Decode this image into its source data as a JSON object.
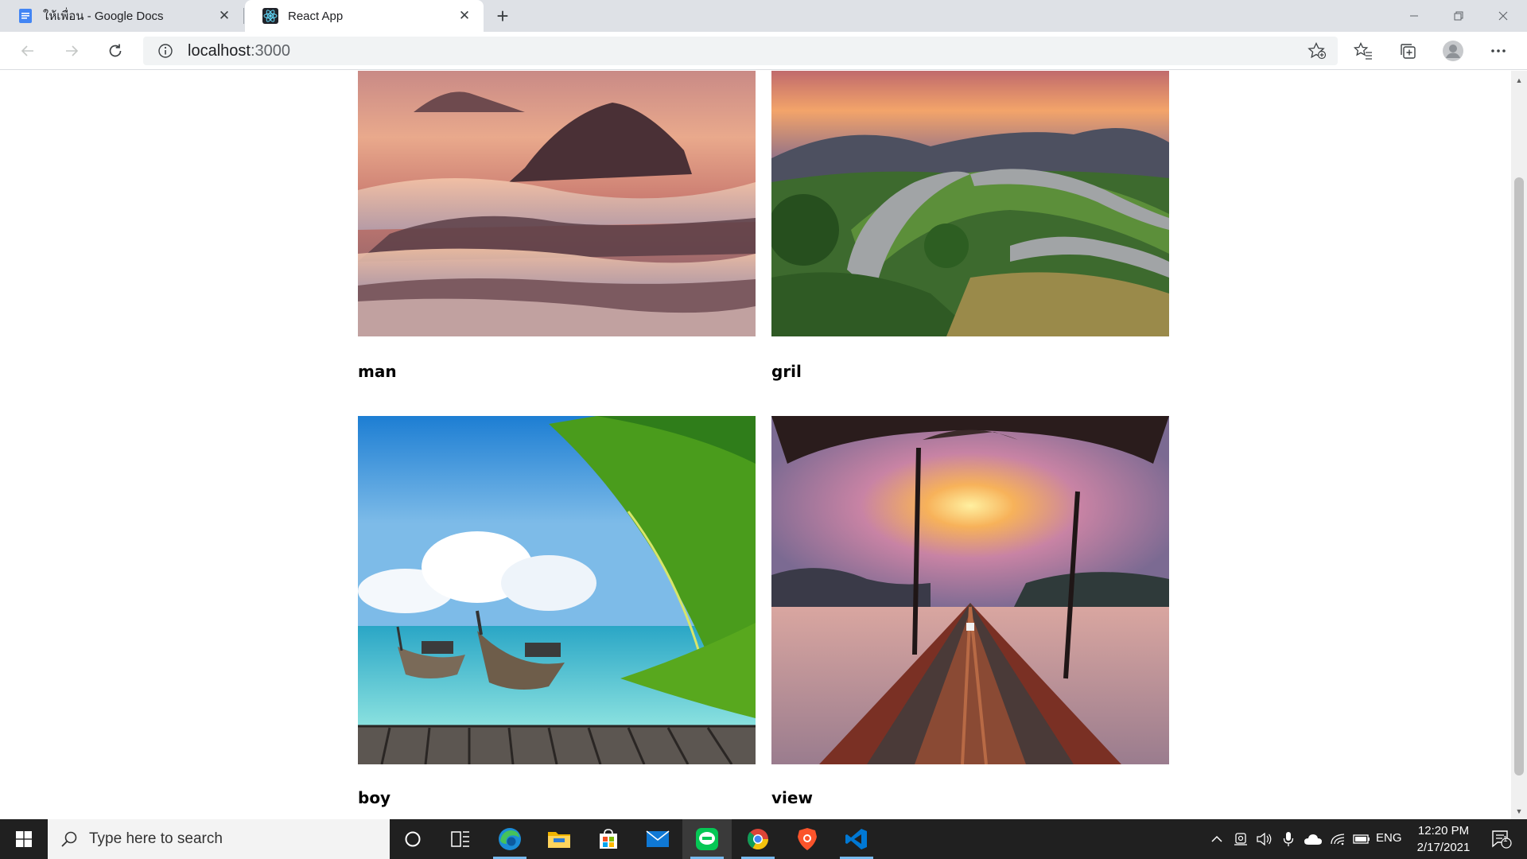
{
  "browser": {
    "tabs": [
      {
        "title": "ให้เพื่อน - Google Docs",
        "icon": "google-docs-icon",
        "active": false
      },
      {
        "title": "React App",
        "icon": "react-icon",
        "active": true
      }
    ],
    "address": {
      "host": "localhost",
      "port": ":3000"
    }
  },
  "gallery": {
    "cards": [
      {
        "label": "man",
        "image": "misty mountains at sunset"
      },
      {
        "label": "gril",
        "image": "winding mountain road"
      },
      {
        "label": "boy",
        "image": "tropical beach with longtail boats and palm leaves"
      },
      {
        "label": "view",
        "image": "boat bow on lake at sunset"
      }
    ]
  },
  "taskbar": {
    "search_placeholder": "Type here to search",
    "language": "ENG",
    "time": "12:20 PM",
    "date": "2/17/2021",
    "notification_count": "1",
    "apps": [
      "task-view-icon",
      "edge-icon",
      "file-explorer-icon",
      "store-icon",
      "mail-icon",
      "line-icon",
      "chrome-icon",
      "brave-icon",
      "vscode-icon"
    ]
  },
  "colors": {
    "tabbar": "#dee1e6",
    "taskbar": "#202020",
    "accent": "#76b9ed",
    "line_green": "#06c755"
  }
}
